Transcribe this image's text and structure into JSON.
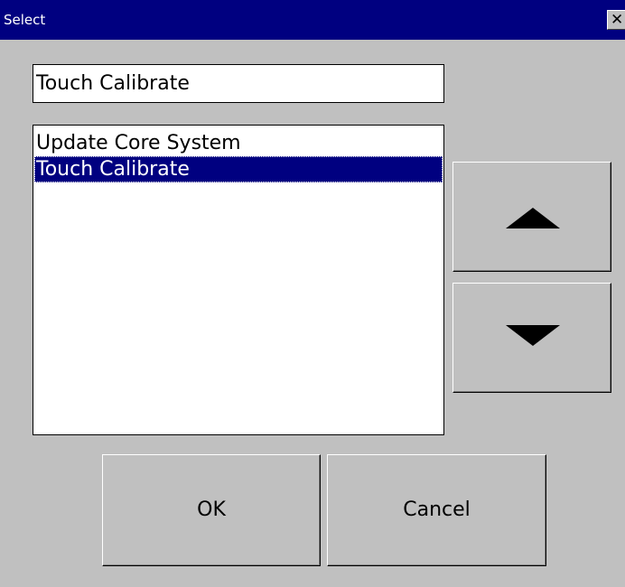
{
  "window": {
    "title": "Select",
    "close_glyph": "✕",
    "close_icon": "close-icon"
  },
  "selection_field": {
    "value": "Touch Calibrate"
  },
  "list": {
    "items": [
      {
        "label": "Update Core System",
        "selected": false
      },
      {
        "label": "Touch Calibrate",
        "selected": true
      }
    ]
  },
  "scroll_buttons": {
    "up_icon": "triangle-up-icon",
    "down_icon": "triangle-down-icon"
  },
  "buttons": {
    "ok_label": "OK",
    "cancel_label": "Cancel"
  },
  "colors": {
    "titlebar": "#000080",
    "selection": "#000080",
    "face": "#c0c0c0"
  }
}
